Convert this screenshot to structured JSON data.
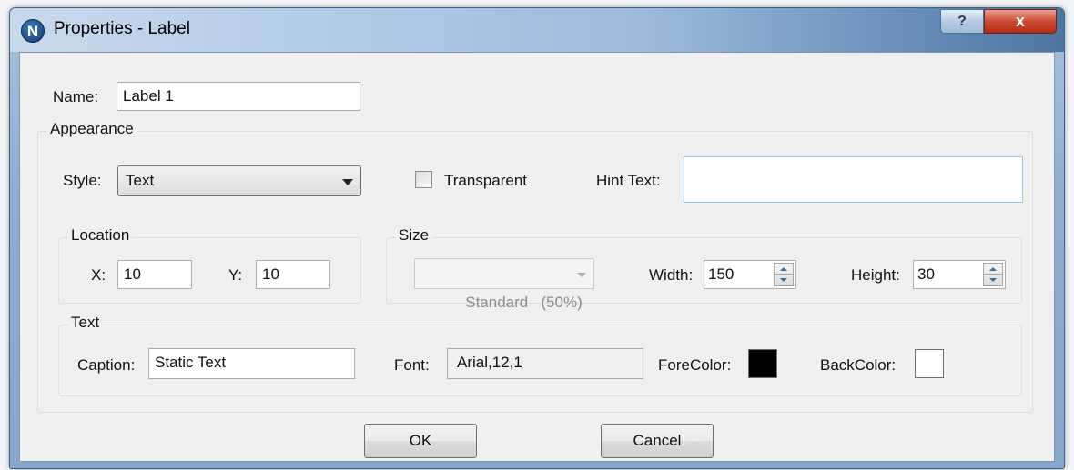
{
  "window": {
    "title": "Properties - Label",
    "icon_letter": "N",
    "help_glyph": "?",
    "close_glyph": "x"
  },
  "name": {
    "label": "Name:",
    "value": "Label 1"
  },
  "appearance": {
    "title": "Appearance",
    "style_label": "Style:",
    "style_value": "Text",
    "transparent_label": "Transparent",
    "transparent_checked": false,
    "hint_label": "Hint Text:",
    "hint_value": ""
  },
  "location": {
    "title": "Location",
    "x_label": "X:",
    "x_value": "10",
    "y_label": "Y:",
    "y_value": "10"
  },
  "size": {
    "title": "Size",
    "preset_value": "Standard   (50%)",
    "width_label": "Width:",
    "width_value": "150",
    "height_label": "Height:",
    "height_value": "30"
  },
  "text": {
    "title": "Text",
    "caption_label": "Caption:",
    "caption_value": "Static Text",
    "font_label": "Font:",
    "font_value": "Arial,12,1",
    "forecolor_label": "ForeColor:",
    "forecolor": "#000000",
    "backcolor_label": "BackColor:",
    "backcolor": "#ffffff"
  },
  "buttons": {
    "ok": "OK",
    "cancel": "Cancel"
  }
}
